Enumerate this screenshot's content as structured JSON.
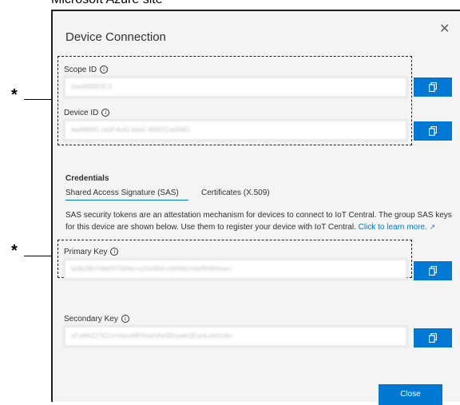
{
  "page": {
    "title": "Microsoft Azure site"
  },
  "dialog": {
    "title": "Device Connection",
    "close_glyph": "✕",
    "close_button_label": "Close"
  },
  "fields": {
    "scope_id": {
      "label": "Scope ID",
      "value": "0ne0005E0C3"
    },
    "device_id": {
      "label": "Device ID",
      "value": "4ad88691-cb2f-4c41-bbd1-960011ad3461"
    },
    "primary_key": {
      "label": "Primary Key",
      "value": "bz8y29UY9b0STfdAbc+yZoUiD2+xWhNyVmeR/9NAno="
    },
    "secondary_key": {
      "label": "Secondary Key",
      "value": "xFuMKjQ7IQ1mYaxuWP9neA4fz6S/yyekQEsmLehGUA="
    }
  },
  "credentials": {
    "title": "Credentials",
    "tabs": [
      {
        "label": "Shared Access Signature (SAS)",
        "selected": true
      },
      {
        "label": "Certificates (X.509)",
        "selected": false
      }
    ],
    "description": "SAS security tokens are an attestation mechanism for devices to connect to IoT Central. The group SAS keys for this device are shown below. Use them to register your device with IoT Central.",
    "link_text": "Click to learn more."
  },
  "annotations": {
    "marker": "*"
  },
  "icons": {
    "info": "info-icon",
    "copy": "copy-icon",
    "external_link": "external-link-icon",
    "close": "close-icon"
  },
  "colors": {
    "accent": "#0078d4",
    "dialog_bg": "#f4f4f4"
  }
}
